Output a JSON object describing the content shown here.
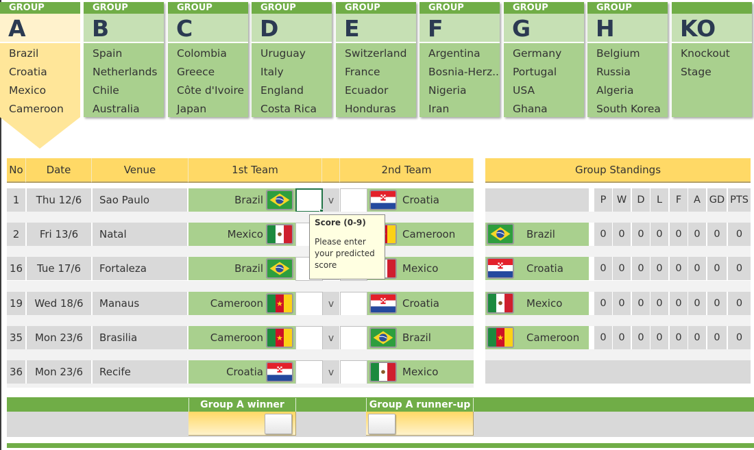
{
  "tabs": [
    {
      "header": "GROUP",
      "letter": "A",
      "teams": [
        "Brazil",
        "Croatia",
        "Mexico",
        "Cameroon"
      ],
      "active": true
    },
    {
      "header": "GROUP",
      "letter": "B",
      "teams": [
        "Spain",
        "Netherlands",
        "Chile",
        "Australia"
      ]
    },
    {
      "header": "GROUP",
      "letter": "C",
      "teams": [
        "Colombia",
        "Greece",
        "Côte d'Ivoire",
        "Japan"
      ]
    },
    {
      "header": "GROUP",
      "letter": "D",
      "teams": [
        "Uruguay",
        "Italy",
        "England",
        "Costa Rica"
      ]
    },
    {
      "header": "GROUP",
      "letter": "E",
      "teams": [
        "Switzerland",
        "France",
        "Ecuador",
        "Honduras"
      ]
    },
    {
      "header": "GROUP",
      "letter": "F",
      "teams": [
        "Argentina",
        "Bosnia-Herz..",
        "Nigeria",
        "Iran"
      ]
    },
    {
      "header": "GROUP",
      "letter": "G",
      "teams": [
        "Germany",
        "Portugal",
        "USA",
        "Ghana"
      ]
    },
    {
      "header": "GROUP",
      "letter": "H",
      "teams": [
        "Belgium",
        "Russia",
        "Algeria",
        "South Korea"
      ]
    },
    {
      "header": "",
      "letter": "KO",
      "teams": [
        "Knockout",
        "Stage",
        "",
        ""
      ]
    }
  ],
  "fixtures": {
    "headers": {
      "no": "No",
      "date": "Date",
      "venue": "Venue",
      "team1": "1st Team",
      "team2": "2nd Team"
    },
    "vs_label": "v",
    "matches": [
      {
        "no": "1",
        "date": "Thu 12/6",
        "venue": "Sao Paulo",
        "team1": "Brazil",
        "flag1": "brazil-flag",
        "score1": "",
        "score2": "",
        "team2": "Croatia",
        "flag2": "croatia-flag"
      },
      {
        "no": "2",
        "date": "Fri 13/6",
        "venue": "Natal",
        "team1": "Mexico",
        "flag1": "mexico-flag",
        "score1": "",
        "score2": "",
        "team2": "Cameroon",
        "flag2": "cameroon-flag"
      },
      {
        "no": "16",
        "date": "Tue 17/6",
        "venue": "Fortaleza",
        "team1": "Brazil",
        "flag1": "brazil-flag",
        "score1": "",
        "score2": "",
        "team2": "Mexico",
        "flag2": "mexico-flag"
      },
      {
        "no": "19",
        "date": "Wed 18/6",
        "venue": "Manaus",
        "team1": "Cameroon",
        "flag1": "cameroon-flag",
        "score1": "",
        "score2": "",
        "team2": "Croatia",
        "flag2": "croatia-flag"
      },
      {
        "no": "35",
        "date": "Mon 23/6",
        "venue": "Brasilia",
        "team1": "Cameroon",
        "flag1": "cameroon-flag",
        "score1": "",
        "score2": "",
        "team2": "Brazil",
        "flag2": "brazil-flag"
      },
      {
        "no": "36",
        "date": "Mon 23/6",
        "venue": "Recife",
        "team1": "Croatia",
        "flag1": "croatia-flag",
        "score1": "",
        "score2": "",
        "team2": "Mexico",
        "flag2": "mexico-flag"
      }
    ]
  },
  "tooltip": {
    "title": "Score (0-9)",
    "body": "Please enter your predicted score"
  },
  "standings": {
    "title": "Group Standings",
    "columns": [
      "P",
      "W",
      "D",
      "L",
      "F",
      "A",
      "GD",
      "PTS"
    ],
    "rows": [
      {
        "team": "Brazil",
        "flag": "brazil-flag",
        "values": [
          "0",
          "0",
          "0",
          "0",
          "0",
          "0",
          "0",
          "0"
        ]
      },
      {
        "team": "Croatia",
        "flag": "croatia-flag",
        "values": [
          "0",
          "0",
          "0",
          "0",
          "0",
          "0",
          "0",
          "0"
        ]
      },
      {
        "team": "Mexico",
        "flag": "mexico-flag",
        "values": [
          "0",
          "0",
          "0",
          "0",
          "0",
          "0",
          "0",
          "0"
        ]
      },
      {
        "team": "Cameroon",
        "flag": "cameroon-flag",
        "values": [
          "0",
          "0",
          "0",
          "0",
          "0",
          "0",
          "0",
          "0"
        ]
      }
    ]
  },
  "qualifiers": {
    "winner_label": "Group A winner",
    "runner_up_label": "Group A runner-up",
    "winner_value": "",
    "runner_up_value": ""
  },
  "colors": {
    "green_dark": "#70ad47",
    "green_light": "#a9d08e",
    "green_pale": "#c6e0b4",
    "yellow": "#ffd966",
    "yellow_light": "#ffe699",
    "grey": "#d9d9d9",
    "letter": "#2b3a52"
  }
}
